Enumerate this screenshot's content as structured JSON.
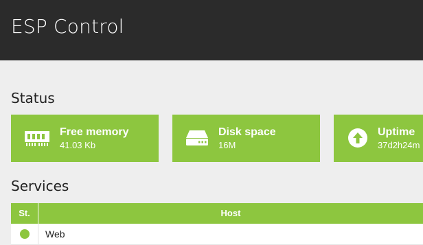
{
  "header": {
    "title": "ESP Control",
    "background": "#2b2b2b"
  },
  "accent_color": "#8dc63f",
  "status": {
    "title": "Status",
    "cards": [
      {
        "label": "Free memory",
        "value": "41.03 Kb",
        "icon": "memory-chip-icon"
      },
      {
        "label": "Disk space",
        "value": "16M",
        "icon": "hard-drive-icon"
      },
      {
        "label": "Uptime",
        "value": "37d2h24m",
        "icon": "up-arrow-circle-icon"
      }
    ]
  },
  "services": {
    "title": "Services",
    "columns": [
      "St.",
      "Host"
    ],
    "rows": [
      {
        "status": "online",
        "host": "Web"
      }
    ]
  }
}
